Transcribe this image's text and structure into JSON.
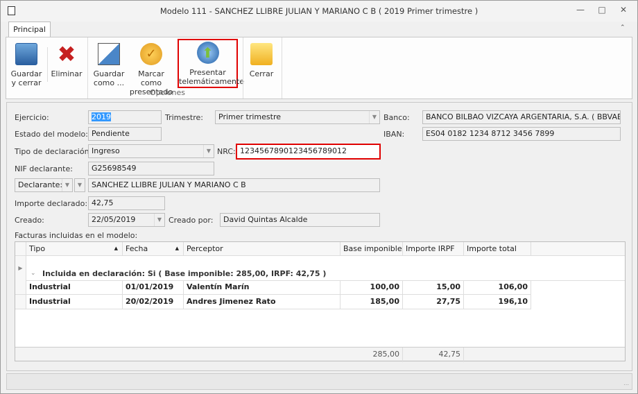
{
  "window": {
    "title": "Modelo 111 -  SANCHEZ LLIBRE JULIAN Y MARIANO C B ( 2019 Primer trimestre )"
  },
  "ribbon": {
    "tab": "Principal",
    "group_label": "Opciones",
    "buttons": [
      {
        "label": "Guardar y cerrar"
      },
      {
        "label": "Eliminar"
      },
      {
        "label": "Guardar como ..."
      },
      {
        "label": "Marcar como presentado"
      },
      {
        "label": "Presentar telemáticamente"
      },
      {
        "label": "Cerrar"
      }
    ]
  },
  "form": {
    "ejercicio_label": "Ejercicio:",
    "ejercicio": "2019",
    "trimestre_label": "Trimestre:",
    "trimestre": "Primer trimestre",
    "banco_label": "Banco:",
    "banco": "BANCO BILBAO VIZCAYA ARGENTARIA, S.A. ( BBVAESMM)",
    "estado_label": "Estado del modelo:",
    "estado": "Pendiente",
    "iban_label": "IBAN:",
    "iban": "ES04 0182 1234 8712 3456 7899",
    "tipo_label": "Tipo de declaración:",
    "tipo": "Ingreso",
    "nrc_label": "NRC:",
    "nrc": "1234567890123456789012",
    "nif_label": "NIF declarante:",
    "nif": "G25698549",
    "declarante_select": "Declarante:",
    "declarante": "SANCHEZ LLIBRE JULIAN Y MARIANO C B",
    "importe_label": "Importe declarado:",
    "importe": "42,75",
    "creado_label": "Creado:",
    "creado": "22/05/2019",
    "creado_por_label": "Creado por:",
    "creado_por": "David Quintas Alcalde",
    "facturas_label": "Facturas incluidas en el modelo:"
  },
  "grid": {
    "columns": [
      "Tipo",
      "Fecha",
      "Perceptor",
      "Base imponible",
      "Importe IRPF",
      "Importe total"
    ],
    "group": "Incluida en declaración: Si ( Base imponible: 285,00,  IRPF: 42,75 )",
    "rows": [
      [
        "Industrial",
        "01/01/2019",
        "Valentín Marín",
        "100,00",
        "15,00",
        "106,00"
      ],
      [
        "Industrial",
        "20/02/2019",
        "Andres Jimenez Rato",
        "185,00",
        "27,75",
        "196,10"
      ]
    ],
    "footer": {
      "base": "285,00",
      "irpf": "42,75"
    }
  },
  "colors": {
    "highlight": "#e00000",
    "selection": "#3399ff"
  }
}
